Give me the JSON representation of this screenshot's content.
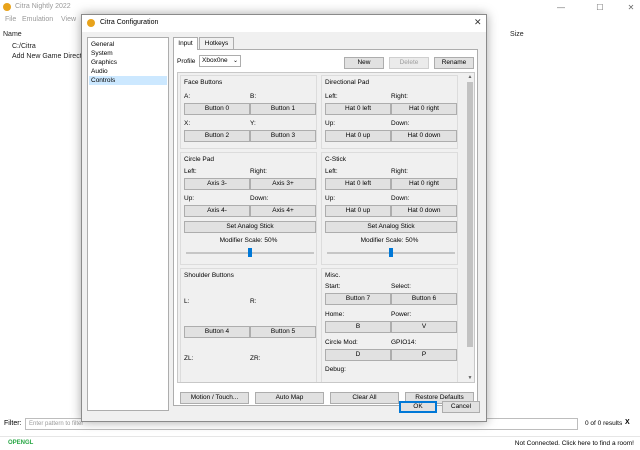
{
  "main_window": {
    "title": "Citra Nightly 2022",
    "menu": [
      "File",
      "Emulation",
      "View"
    ],
    "columns": {
      "name": "Name",
      "size": "Size"
    },
    "rows": [
      "C:/Citra",
      "Add New Game Directory"
    ],
    "filter": {
      "label": "Filter:",
      "placeholder": "Enter pattern to filter",
      "count": "0 of 0 results",
      "clear": "X"
    },
    "status": {
      "renderer": "OPENGL",
      "connection": "Not Connected. Click here to find a room!"
    },
    "controls": {
      "minimize": "—",
      "maximize": "☐",
      "close": "✕"
    }
  },
  "dialog": {
    "title": "Citra Configuration",
    "close": "✕",
    "nav": [
      "General",
      "System",
      "Graphics",
      "Audio",
      "Controls"
    ],
    "selected_nav": "Controls",
    "tabs": [
      "Input",
      "Hotkeys"
    ],
    "active_tab": "Input",
    "profile": {
      "label": "Profile",
      "value": "Xbox0ne",
      "buttons": {
        "new": "New",
        "delete": "Delete",
        "rename": "Rename"
      }
    },
    "face_buttons": {
      "title": "Face Buttons",
      "a": {
        "label": "A:",
        "value": "Button 0"
      },
      "b": {
        "label": "B:",
        "value": "Button 1"
      },
      "x": {
        "label": "X:",
        "value": "Button 2"
      },
      "y": {
        "label": "Y:",
        "value": "Button 3"
      }
    },
    "directional_pad": {
      "title": "Directional Pad",
      "left": {
        "label": "Left:",
        "value": "Hat 0 left"
      },
      "right": {
        "label": "Right:",
        "value": "Hat 0 right"
      },
      "up": {
        "label": "Up:",
        "value": "Hat 0 up"
      },
      "down": {
        "label": "Down:",
        "value": "Hat 0 down"
      }
    },
    "circle_pad": {
      "title": "Circle Pad",
      "left": {
        "label": "Left:",
        "value": "Axis 3-"
      },
      "right": {
        "label": "Right:",
        "value": "Axis 3+"
      },
      "up": {
        "label": "Up:",
        "value": "Axis 4-"
      },
      "down": {
        "label": "Down:",
        "value": "Axis 4+"
      },
      "set_analog": "Set Analog Stick",
      "modifier_label": "Modifier Scale: 50%",
      "modifier_value": 0.5
    },
    "c_stick": {
      "title": "C-Stick",
      "left": {
        "label": "Left:",
        "value": "Hat 0 left"
      },
      "right": {
        "label": "Right:",
        "value": "Hat 0 right"
      },
      "up": {
        "label": "Up:",
        "value": "Hat 0 up"
      },
      "down": {
        "label": "Down:",
        "value": "Hat 0 down"
      },
      "set_analog": "Set Analog Stick",
      "modifier_label": "Modifier Scale: 50%",
      "modifier_value": 0.5
    },
    "shoulder_buttons": {
      "title": "Shoulder Buttons",
      "l": {
        "label": "L:",
        "value": "Button 4"
      },
      "r": {
        "label": "R:",
        "value": "Button 5"
      },
      "zl": {
        "label": "ZL:"
      },
      "zr": {
        "label": "ZR:"
      }
    },
    "misc": {
      "title": "Misc.",
      "start": {
        "label": "Start:",
        "value": "Button 7"
      },
      "select": {
        "label": "Select:",
        "value": "Button 6"
      },
      "home": {
        "label": "Home:",
        "value": "B"
      },
      "power": {
        "label": "Power:",
        "value": "V"
      },
      "circle_mod": {
        "label": "Circle Mod:",
        "value": "D"
      },
      "gpio14": {
        "label": "GPIO14:",
        "value": "P"
      },
      "debug": {
        "label": "Debug:"
      }
    },
    "actions": {
      "motion_touch": "Motion / Touch...",
      "auto_map": "Auto Map",
      "clear_all": "Clear All",
      "restore_defaults": "Restore Defaults"
    },
    "ok": "OK",
    "cancel": "Cancel"
  }
}
